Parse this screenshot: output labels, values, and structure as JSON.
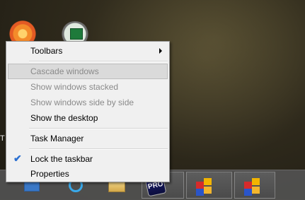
{
  "desktop": {
    "partial_label": "T"
  },
  "context_menu": {
    "items": [
      {
        "label": "Toolbars",
        "enabled": true,
        "submenu": true
      },
      {
        "label": "Cascade windows",
        "enabled": false,
        "highlighted": true
      },
      {
        "label": "Show windows stacked",
        "enabled": false
      },
      {
        "label": "Show windows side by side",
        "enabled": false
      },
      {
        "label": "Show the desktop",
        "enabled": true
      },
      {
        "label": "Task Manager",
        "enabled": true
      },
      {
        "label": "Lock the taskbar",
        "enabled": true,
        "checked": true
      },
      {
        "label": "Properties",
        "enabled": true
      }
    ],
    "check_glyph": "✔"
  },
  "taskbar": {
    "pro_label": "PRO"
  },
  "icons": [
    "flower-icon",
    "excel-icon",
    "internet-explorer-icon",
    "file-explorer-icon",
    "pro-app-icon",
    "office-icon"
  ]
}
